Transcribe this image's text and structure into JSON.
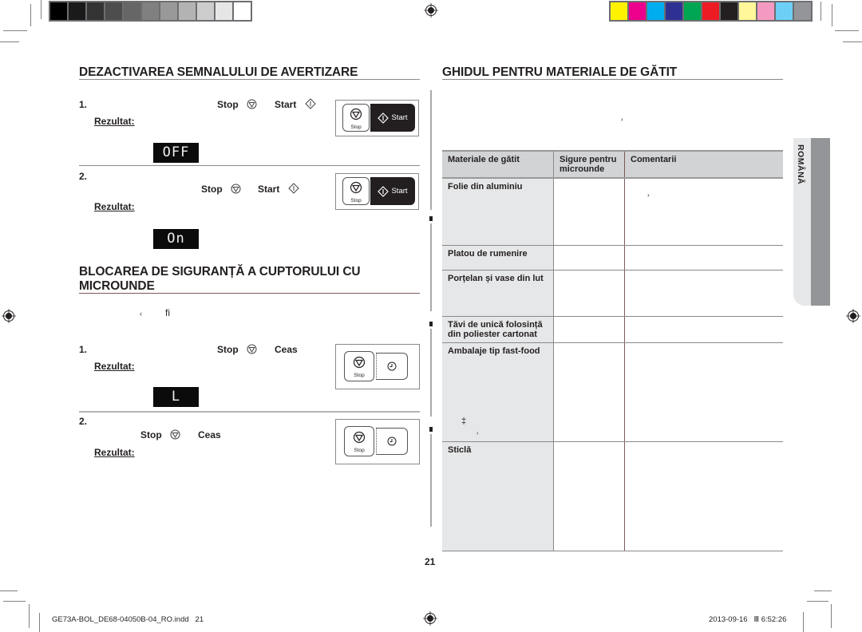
{
  "colorbars": {
    "grayscale": [
      "#000000",
      "#1a1a1a",
      "#333333",
      "#4d4d4d",
      "#666666",
      "#808080",
      "#999999",
      "#b3b3b3",
      "#cccccc",
      "#e6e6e6",
      "#ffffff"
    ],
    "process": [
      "#fff200",
      "#ec008c",
      "#00aeef",
      "#2e3192",
      "#00a651",
      "#ed1c24",
      "#231f20",
      "#fff799",
      "#f49ac1",
      "#6dcff6",
      "#939598"
    ]
  },
  "left": {
    "section1": {
      "title": "DEZACTIVAREA SEMNALULUI DE AVERTIZARE",
      "steps": [
        {
          "number": "1.",
          "key1": "Stop",
          "key2": "Start",
          "result_label": "Rezultat:",
          "display": "OFF",
          "panel": {
            "stop_label": "Stop",
            "start_label": "Start"
          }
        },
        {
          "number": "2.",
          "key1": "Stop",
          "key2": "Start",
          "result_label": "Rezultat:",
          "display": "On",
          "panel": {
            "stop_label": "Stop",
            "start_label": "Start"
          }
        }
      ]
    },
    "section2": {
      "title_line1": "BLOCAREA DE SIGURANȚĂ A CUPTORULUI CU",
      "title_line2": "MICROUNDE",
      "intro_fragment_1": "‹",
      "intro_fragment_2": "fi",
      "steps": [
        {
          "number": "1.",
          "key1": "Stop",
          "key2": "Ceas",
          "result_label": "Rezultat:",
          "display": "L",
          "panel": {
            "stop_label": "Stop"
          }
        },
        {
          "number": "2.",
          "key1": "Stop",
          "key2": "Ceas",
          "result_label": "Rezultat:",
          "panel": {
            "stop_label": "Stop"
          }
        }
      ]
    }
  },
  "right": {
    "title": "GHIDUL PENTRU MATERIALE DE GĂTIT",
    "intro_fragment": "›",
    "table": {
      "headers": [
        "Materiale de gătit",
        "Sigure pentru microunde",
        "Comentarii"
      ],
      "rows": [
        {
          "material": "Folie din aluminiu",
          "safe": "",
          "comment": "›"
        },
        {
          "material": "Platou de rumenire",
          "safe": "",
          "comment": ""
        },
        {
          "material": "Porțelan și vase din lut",
          "safe": "",
          "comment": ""
        },
        {
          "material": "Tăvi de unică folosință din poliester cartonat",
          "safe": "",
          "comment": ""
        },
        {
          "material": "Ambalaje tip fast-food",
          "safe": "",
          "comment": "",
          "extra": "‡",
          "extra2": "›"
        },
        {
          "material": "Sticlă",
          "safe": "",
          "comment": ""
        }
      ]
    },
    "language_tab": "ROMÂNĂ"
  },
  "page_number": "21",
  "footer": {
    "file": "GE73A-BOL_DE68-04050B-04_RO.indd   21",
    "timestamp": "2013-09-16   Ⅲ 6:52:26"
  }
}
